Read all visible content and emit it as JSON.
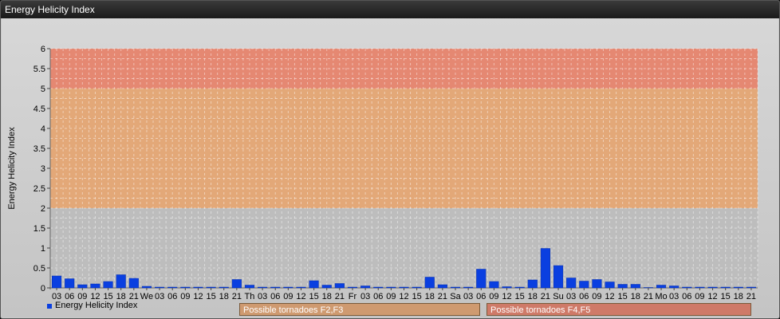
{
  "window": {
    "title": "Energy Helicity Index"
  },
  "legend": {
    "label": "Energy Helicity Index",
    "color": "#0a3fe0"
  },
  "band_labels": [
    {
      "text": "Possible tornadoes F2,F3",
      "color": "#cf9a70"
    },
    {
      "text": "Possible tornadoes F4,F5",
      "color": "#cf7a68"
    }
  ],
  "chart_data": {
    "type": "bar",
    "title": "",
    "ylabel": "Energy Helicity Index",
    "xlabel": "",
    "ylim": [
      0,
      6
    ],
    "yticks": [
      "0",
      "0.5",
      "1",
      "1.5",
      "2",
      "2.5",
      "3",
      "3.5",
      "4",
      "4.5",
      "5",
      "5.5",
      "6"
    ],
    "grid": true,
    "legend_position": "bottom-left",
    "bands": [
      {
        "from": 0,
        "to": 2,
        "color": "#bdbdbd"
      },
      {
        "from": 2,
        "to": 5,
        "color": "#e3a878"
      },
      {
        "from": 5,
        "to": 6,
        "color": "#e58872"
      }
    ],
    "categories": [
      "03",
      "06",
      "09",
      "12",
      "15",
      "18",
      "21",
      "We",
      "03",
      "06",
      "09",
      "12",
      "15",
      "18",
      "21",
      "Th",
      "03",
      "06",
      "09",
      "12",
      "15",
      "18",
      "21",
      "Fr",
      "03",
      "06",
      "09",
      "12",
      "15",
      "18",
      "21",
      "Sa",
      "03",
      "06",
      "09",
      "12",
      "15",
      "18",
      "21",
      "Su",
      "03",
      "06",
      "09",
      "12",
      "15",
      "18",
      "21",
      "Mo",
      "03",
      "06",
      "09",
      "12",
      "15",
      "18",
      "21"
    ],
    "series": [
      {
        "color": "#0a3fe0",
        "values": [
          0.3,
          0.23,
          0.08,
          0.1,
          0.16,
          0.33,
          0.24,
          0.04,
          0.02,
          0.02,
          0.02,
          0.02,
          0.02,
          0.02,
          0.21,
          0.07,
          0.02,
          0.02,
          0.02,
          0.02,
          0.18,
          0.07,
          0.11,
          0.02,
          0.05,
          0.02,
          0.02,
          0.02,
          0.02,
          0.27,
          0.08,
          0.02,
          0.02,
          0.47,
          0.16,
          0.03,
          0.02,
          0.2,
          0.99,
          0.56,
          0.25,
          0.17,
          0.21,
          0.15,
          0.09,
          0.09,
          0.01,
          0.07,
          0.05,
          0.02,
          0.02,
          0.02,
          0.02,
          0.02,
          0.02
        ]
      }
    ]
  }
}
